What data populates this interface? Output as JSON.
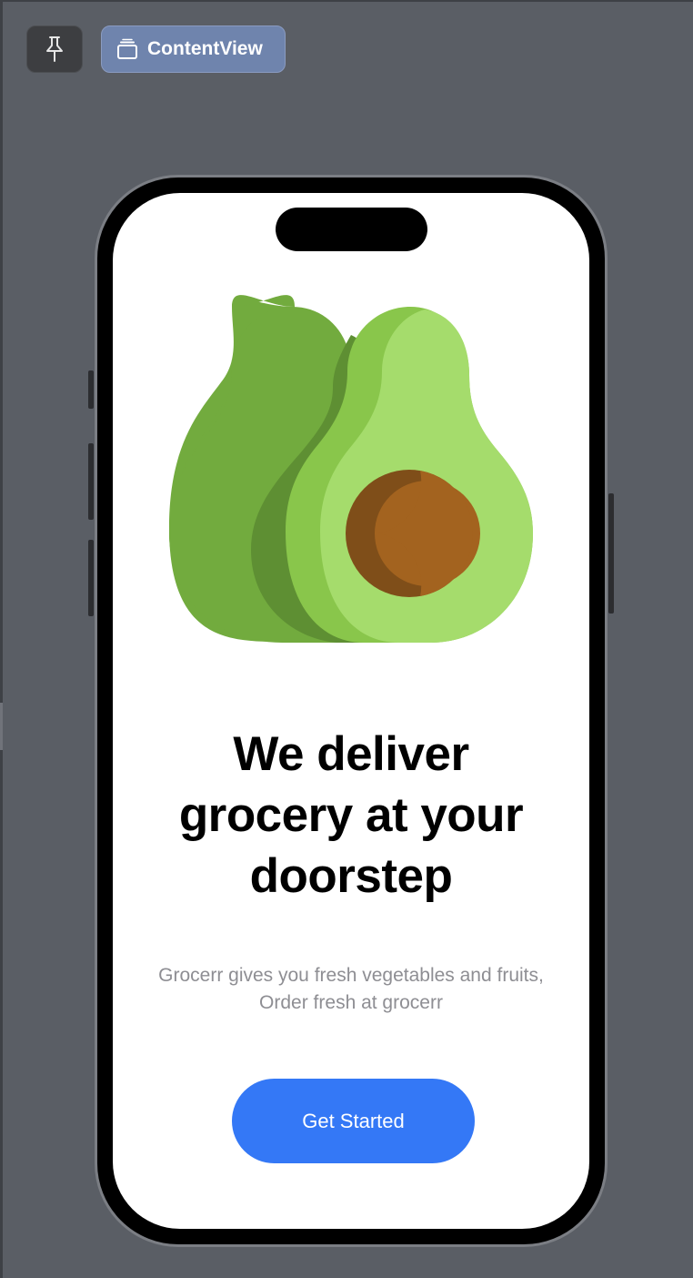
{
  "toolbar": {
    "pin_icon": "pin-icon",
    "view_icon": "stack-icon",
    "view_label": "ContentView"
  },
  "onboarding": {
    "illustration": "avocado",
    "headline_lines": [
      "We deliver",
      "grocery at your",
      "doorstep"
    ],
    "subtext_lines": [
      "Grocerr gives you fresh vegetables and fruits,",
      "Order fresh at grocerr"
    ],
    "cta_label": "Get Started"
  },
  "colors": {
    "background": "#5a5e65",
    "accent_button": "#3478f6",
    "toolbar_active": "#6f84ad",
    "avocado_dark": "#72ab3e",
    "avocado_light": "#a5dc6c",
    "pit": "#a3631f"
  }
}
